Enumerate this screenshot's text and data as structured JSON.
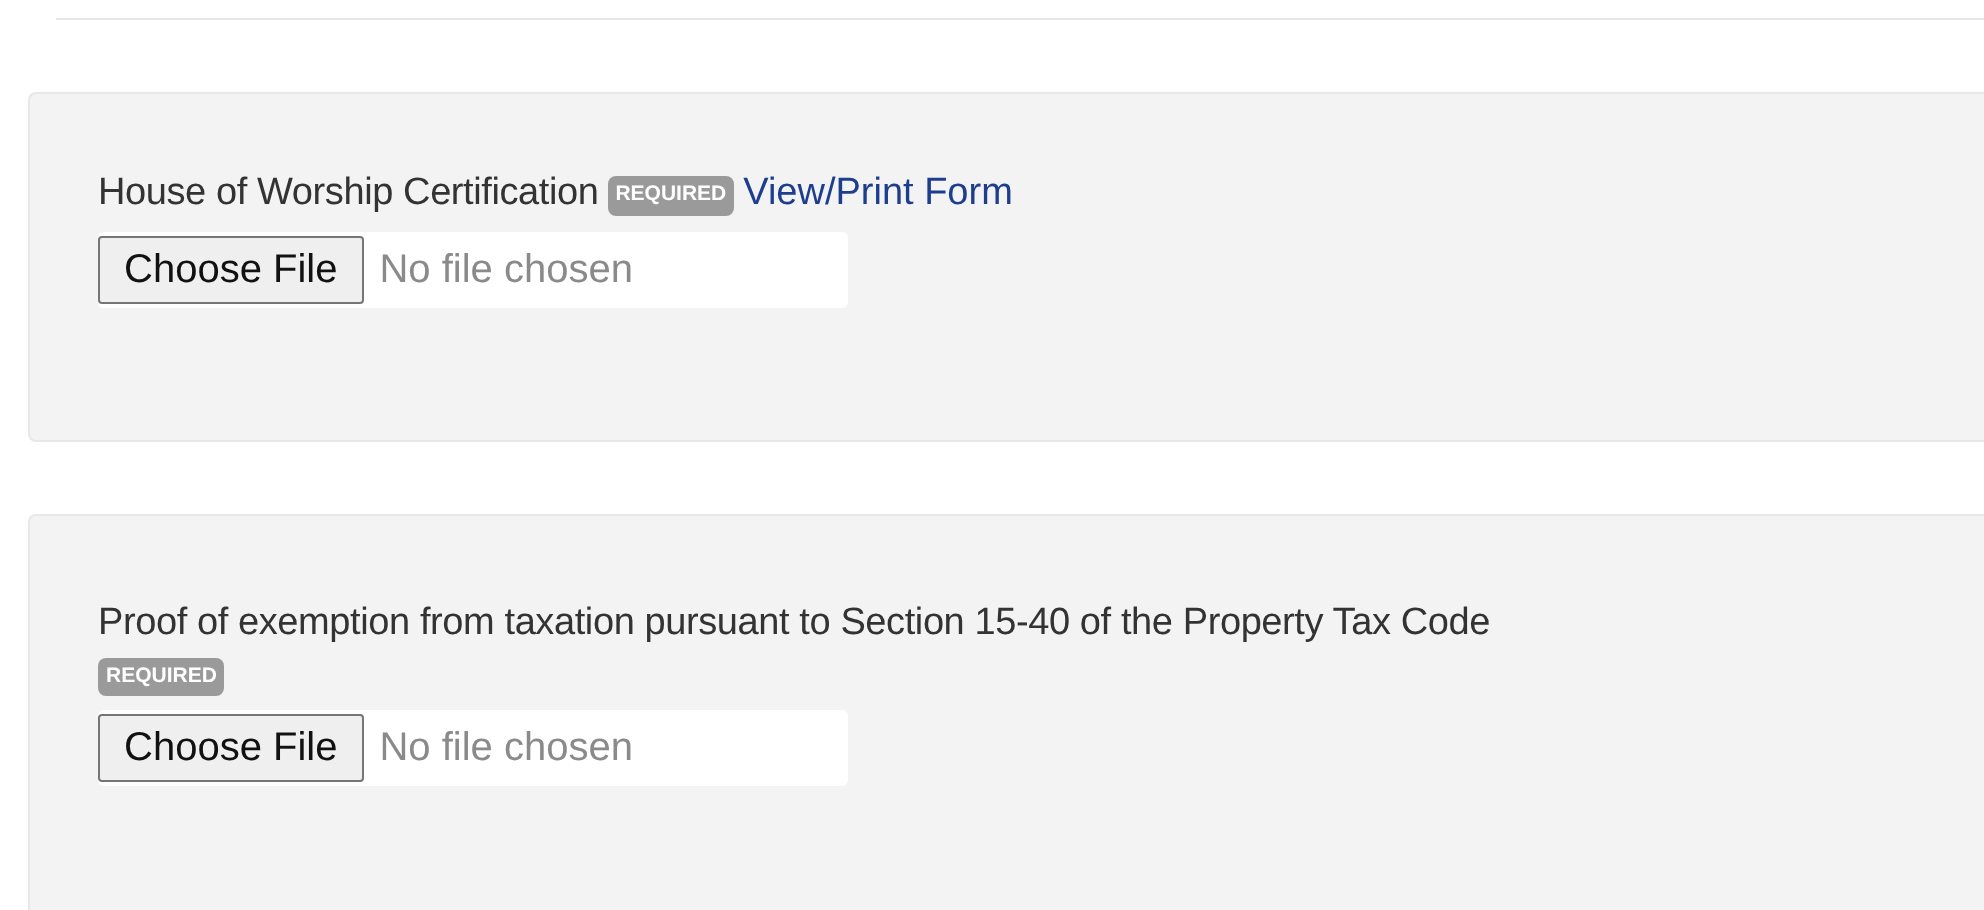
{
  "uploads": [
    {
      "label": "House of Worship Certification",
      "required_badge": "REQUIRED",
      "link": "View/Print Form",
      "button": "Choose File",
      "status": "No file chosen"
    },
    {
      "label": "Proof of exemption from taxation pursuant to Section 15-40 of the Property Tax Code",
      "required_badge": "REQUIRED",
      "button": "Choose File",
      "status": "No file chosen"
    }
  ]
}
